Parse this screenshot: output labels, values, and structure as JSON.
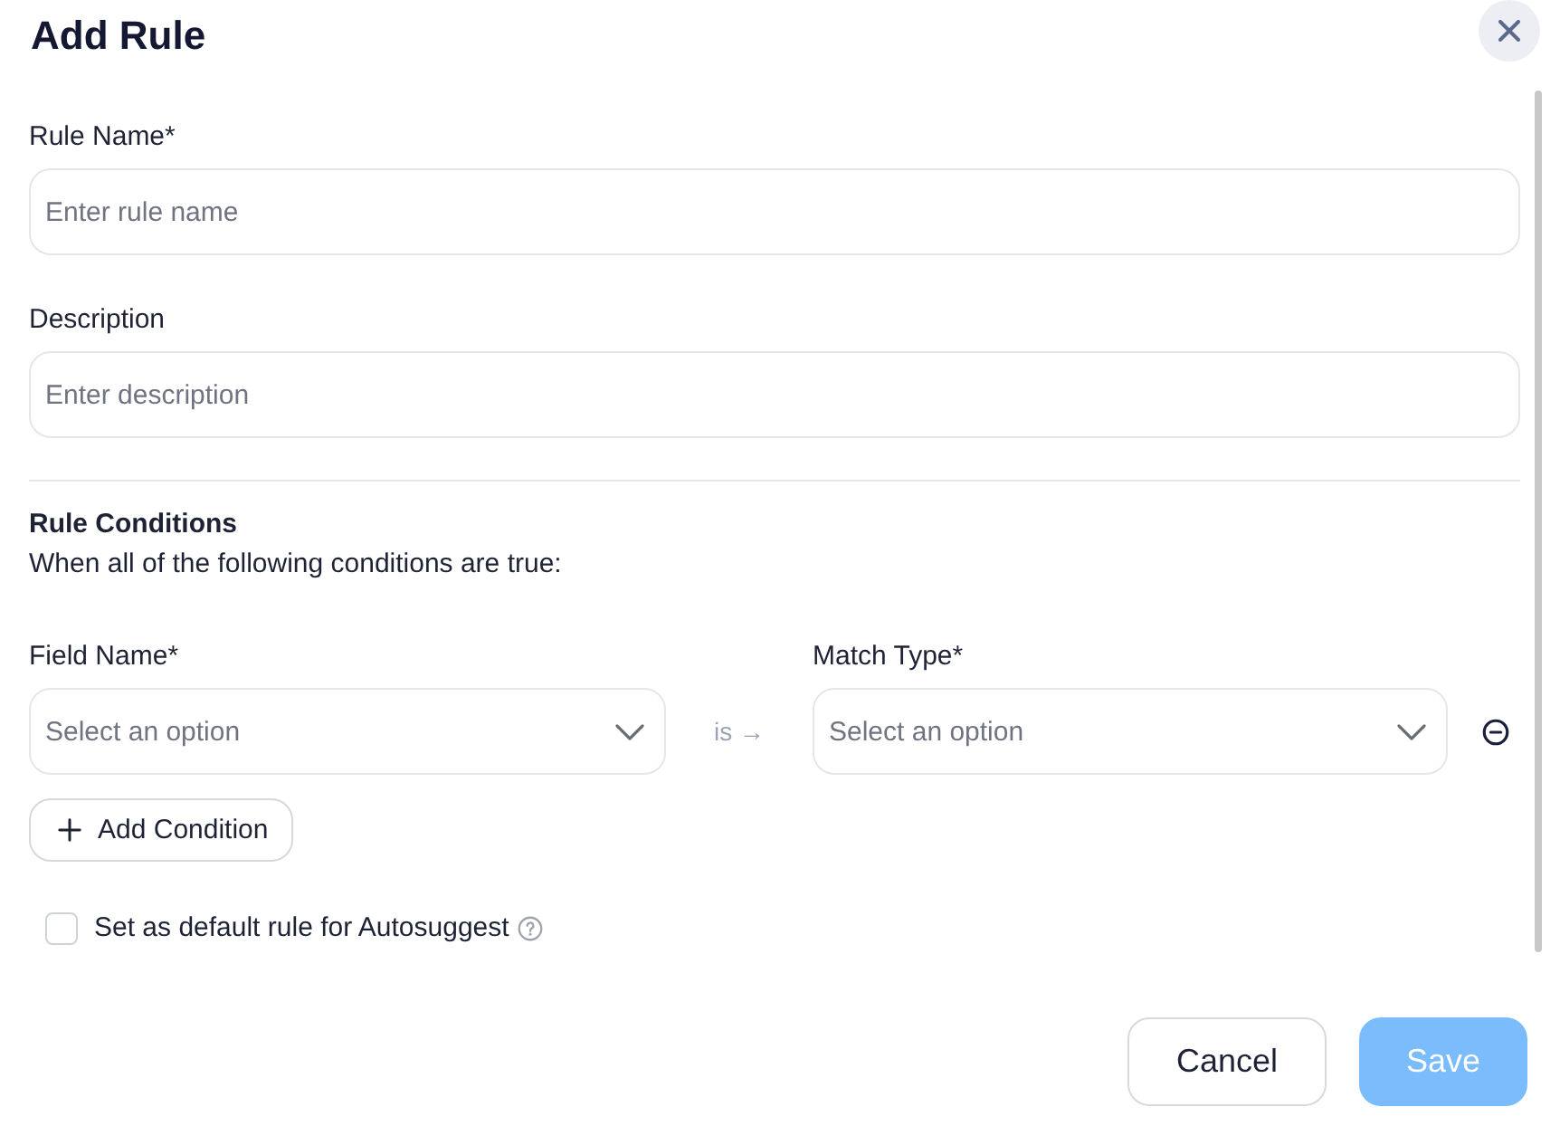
{
  "dialog": {
    "title": "Add Rule"
  },
  "fields": [
    {
      "label": "Rule Name*",
      "placeholder": "Enter rule name"
    },
    {
      "label": "Description",
      "placeholder": "Enter description"
    }
  ],
  "rule_conditions": {
    "title": "Rule Conditions",
    "subtitle": "When all of the following conditions are true:",
    "conditions": [
      {
        "field_name": {
          "label": "Field Name*",
          "placeholder": "Select an option"
        },
        "operator": "is →",
        "match_type": {
          "label": "Match Type*",
          "placeholder": "Select an option"
        }
      }
    ],
    "add_button": "Add Condition"
  },
  "default_rule": {
    "label": "Set as default rule for Autosuggest",
    "checked": false
  },
  "buttons": [
    {
      "label": "Cancel",
      "kind": "secondary",
      "disabled": false
    },
    {
      "label": "Save",
      "kind": "primary",
      "disabled": true
    }
  ]
}
